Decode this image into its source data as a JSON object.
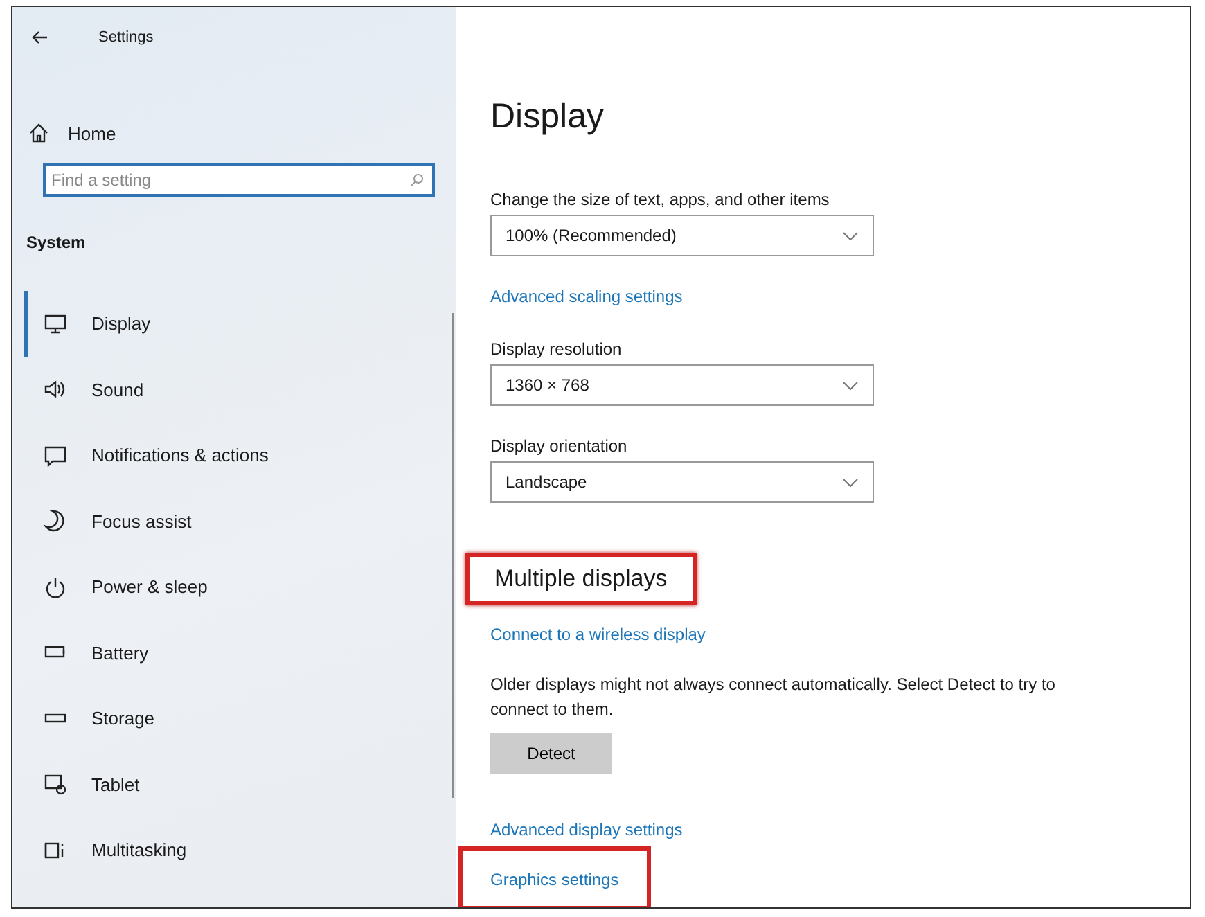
{
  "window": {
    "title": "Settings"
  },
  "sidebar": {
    "home": "Home",
    "search": {
      "placeholder": "Find a setting"
    },
    "section": "System",
    "items": [
      {
        "label": "Display",
        "selected": true
      },
      {
        "label": "Sound",
        "selected": false
      },
      {
        "label": "Notifications & actions",
        "selected": false
      },
      {
        "label": "Focus assist",
        "selected": false
      },
      {
        "label": "Power & sleep",
        "selected": false
      },
      {
        "label": "Battery",
        "selected": false
      },
      {
        "label": "Storage",
        "selected": false
      },
      {
        "label": "Tablet",
        "selected": false
      },
      {
        "label": "Multitasking",
        "selected": false
      }
    ]
  },
  "content": {
    "title": "Display",
    "settings": [
      {
        "kind": "dropdown",
        "label": "Change the size of text, apps, and other items",
        "value": "100% (Recommended)"
      },
      {
        "kind": "link",
        "label": "Advanced scaling settings"
      },
      {
        "kind": "dropdown",
        "label": "Display resolution",
        "value": "1360 × 768"
      },
      {
        "kind": "dropdown",
        "label": "Display orientation",
        "value": "Landscape"
      },
      {
        "kind": "heading",
        "label": "Multiple displays",
        "highlighted": true
      },
      {
        "kind": "link",
        "label": "Connect to a wireless display",
        "highlighted": false
      },
      {
        "kind": "text",
        "label": "Older displays might not always connect automatically. Select Detect to try to connect to them."
      },
      {
        "kind": "button",
        "label": "Detect"
      },
      {
        "kind": "link",
        "label": "Advanced display settings",
        "highlighted": false
      },
      {
        "kind": "link",
        "label": "Graphics settings",
        "highlighted": true
      }
    ]
  }
}
